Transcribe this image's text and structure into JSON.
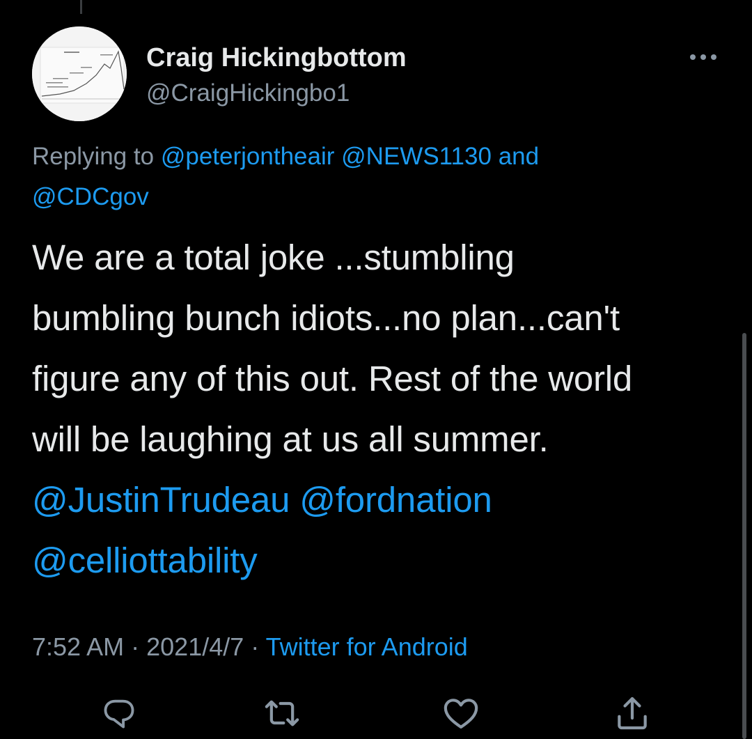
{
  "user": {
    "display_name": "Craig Hickingbottom",
    "handle": "@CraigHickingbo1"
  },
  "reply": {
    "prefix": "Replying to",
    "mention_1": "@peterjontheair",
    "mention_2": "@NEWS1130",
    "conjunction": "and",
    "mention_3": "@CDCgov"
  },
  "tweet": {
    "line_1": "We are a total joke ...stumbling",
    "line_2": "bumbling bunch idiots...no plan...can't",
    "line_3": "figure any of this out. Rest of the world",
    "line_4": "will be laughing at us all summer.",
    "mention_1": "@JustinTrudeau",
    "mention_2": "@fordnation",
    "mention_3": "@celliottability"
  },
  "meta": {
    "time": "7:52 AM",
    "separator": "·",
    "date": "2021/4/7",
    "source": "Twitter for Android"
  },
  "icons": {
    "more": "more-horizontal-icon",
    "reply": "reply-icon",
    "retweet": "retweet-icon",
    "like": "heart-icon",
    "share": "share-icon"
  },
  "colors": {
    "background": "#000000",
    "text": "#e7e9ea",
    "secondary_text": "#8b98a5",
    "link": "#1d9bf0"
  }
}
